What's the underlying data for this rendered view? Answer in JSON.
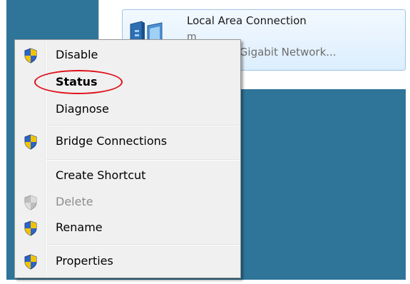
{
  "network": {
    "name": "Local Area Connection",
    "line2": "m",
    "line3": "82577LM Gigabit Network..."
  },
  "menu": {
    "items": [
      {
        "label": "Disable",
        "icon": "shield-icon",
        "enabled": true
      },
      {
        "label": "Status",
        "icon": null,
        "enabled": true,
        "bold": true,
        "highlighted": true
      },
      {
        "label": "Diagnose",
        "icon": null,
        "enabled": true
      },
      {
        "label": "Bridge Connections",
        "icon": "shield-icon",
        "enabled": true
      },
      {
        "label": "Create Shortcut",
        "icon": null,
        "enabled": true
      },
      {
        "label": "Delete",
        "icon": "shield-icon",
        "enabled": false
      },
      {
        "label": "Rename",
        "icon": "shield-icon",
        "enabled": true
      },
      {
        "label": "Properties",
        "icon": "shield-icon",
        "enabled": true
      }
    ]
  },
  "colors": {
    "desktop": "#2e7599",
    "highlight_ring": "#e0101a",
    "menu_background": "#f0f0f0"
  }
}
